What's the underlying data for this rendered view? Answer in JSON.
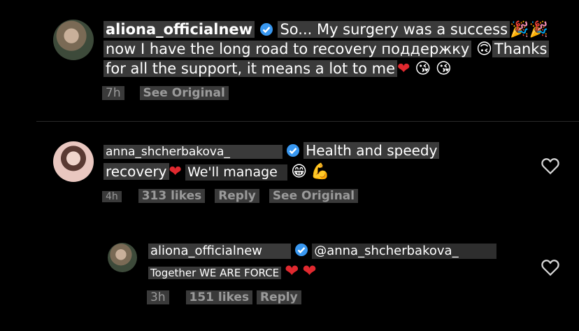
{
  "comment1": {
    "username": "aliona_officialnew",
    "text_line1": "So... My surgery was a success",
    "text_line2": "now I have the long road to recovery поддержку",
    "text_line2b": "Thanks",
    "text_line3": "for all the support, it means a lot to me",
    "time": "7h",
    "see_original": "See Original"
  },
  "comment2": {
    "username": "anna_shcherbakova_",
    "text_line1": "Health and speedy",
    "text_line2a": "recovery",
    "text_line2b": "We'll manage",
    "time": "4h",
    "likes": "313 likes",
    "reply": "Reply",
    "see_original": "See Original"
  },
  "reply1": {
    "username": "aliona_officialnew",
    "mention": "@anna_shcherbakova_",
    "text": "Together WE ARE FORCE",
    "time": "3h",
    "likes": "151 likes",
    "reply": "Reply"
  },
  "icons": [
    "verified-badge-icon",
    "heart-outline-icon",
    "party-popper-icon",
    "red-heart-emoji",
    "upside-down-face-emoji",
    "kiss-emoji",
    "grin-emoji",
    "flexed-biceps-emoji"
  ],
  "colors": {
    "background": "#000000",
    "highlight": "#3a3a3a",
    "verified": "#3897f0",
    "meta": "#9a9a9a",
    "heart": "#e0292f"
  }
}
